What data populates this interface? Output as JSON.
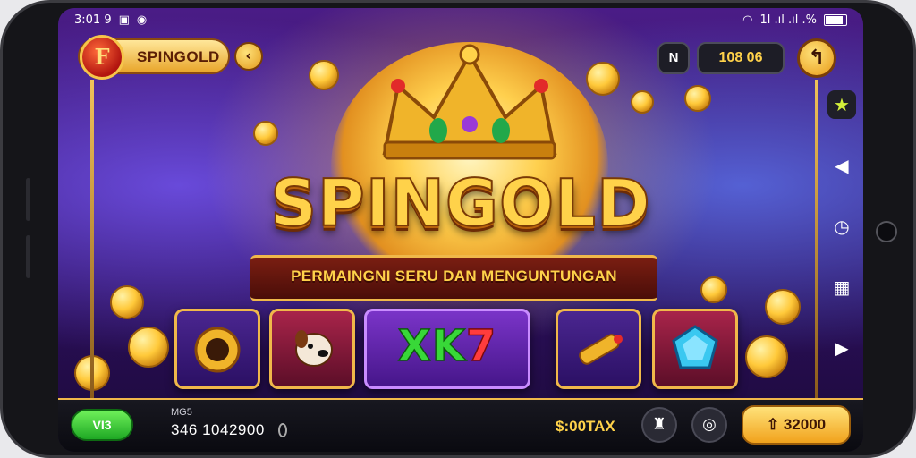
{
  "status_bar": {
    "time": "3:01 9",
    "right_text": "1l .ıl .ıl .%"
  },
  "header": {
    "logo_mark": "F",
    "brand": "SPINGOLD",
    "n_label": "N",
    "balance_top": "108 06"
  },
  "hero": {
    "title": "SPINGOLD",
    "subtitle": "PERMAINGNI SERU DAN MENGUNTUNGAN"
  },
  "tiles": {
    "featured_left": "XK",
    "featured_right": "7"
  },
  "bottom": {
    "left_button": "VI3",
    "info_label": "MG5 ",
    "info_value": "346  1042900",
    "balance_label": "$:00TAX",
    "spin_label": "32000"
  },
  "colors": {
    "gold": "#ffd24a",
    "purple": "#4a1c86",
    "green": "#38d838",
    "red": "#ff3c3c"
  },
  "icons": [
    "back-arrow-icon",
    "return-icon",
    "star-icon",
    "back-icon",
    "clock-icon",
    "gift-icon",
    "play-icon",
    "crown-icon",
    "chip-icon",
    "dog-icon",
    "scroll-icon",
    "gem-icon",
    "rocket-icon",
    "target-icon"
  ]
}
